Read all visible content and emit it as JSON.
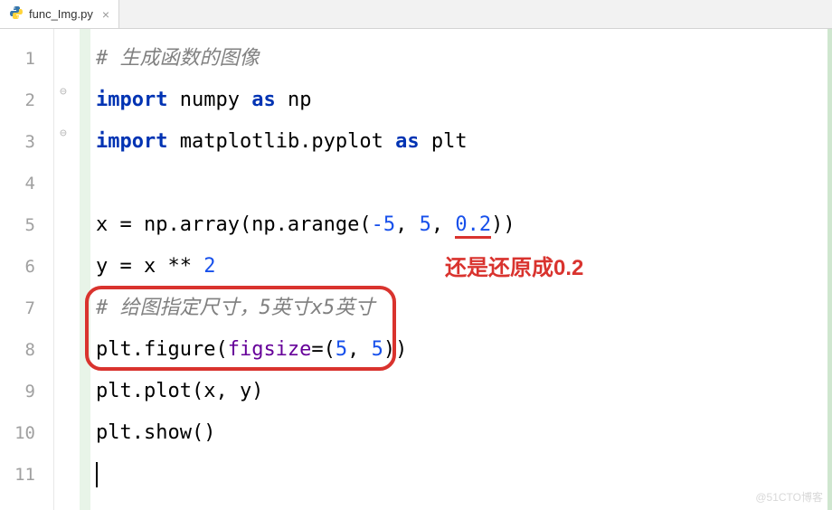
{
  "tab": {
    "filename": "func_Img.py",
    "close_glyph": "×"
  },
  "line_numbers": [
    "1",
    "2",
    "3",
    "4",
    "5",
    "6",
    "7",
    "8",
    "9",
    "10",
    "11"
  ],
  "code": {
    "l1_comment": "# 生成函数的图像",
    "import_kw": "import",
    "as_kw": "as",
    "numpy": "numpy",
    "np_alias": "np",
    "matplotlib": "matplotlib.pyplot",
    "plt_alias": "plt",
    "l5_prefix": "x = np.array(np.arange(",
    "l5_a": "-5",
    "l5_sep1": ", ",
    "l5_b": "5",
    "l5_sep2": ", ",
    "l5_c": "0.2",
    "l5_suffix": "))",
    "l6_prefix": "y = x ** ",
    "l6_exp": "2",
    "l7_comment": "# 给图指定尺寸，5英寸x5英寸",
    "l8_prefix": "plt.figure(",
    "l8_param": "figsize",
    "l8_mid": "=(",
    "l8_a": "5",
    "l8_sep": ", ",
    "l8_b": "5",
    "l8_suffix": "))",
    "l9": "plt.plot(x, y)",
    "l10": "plt.show()"
  },
  "annotation": {
    "text": "还是还原成0.2"
  },
  "watermark": "@51CTO博客"
}
